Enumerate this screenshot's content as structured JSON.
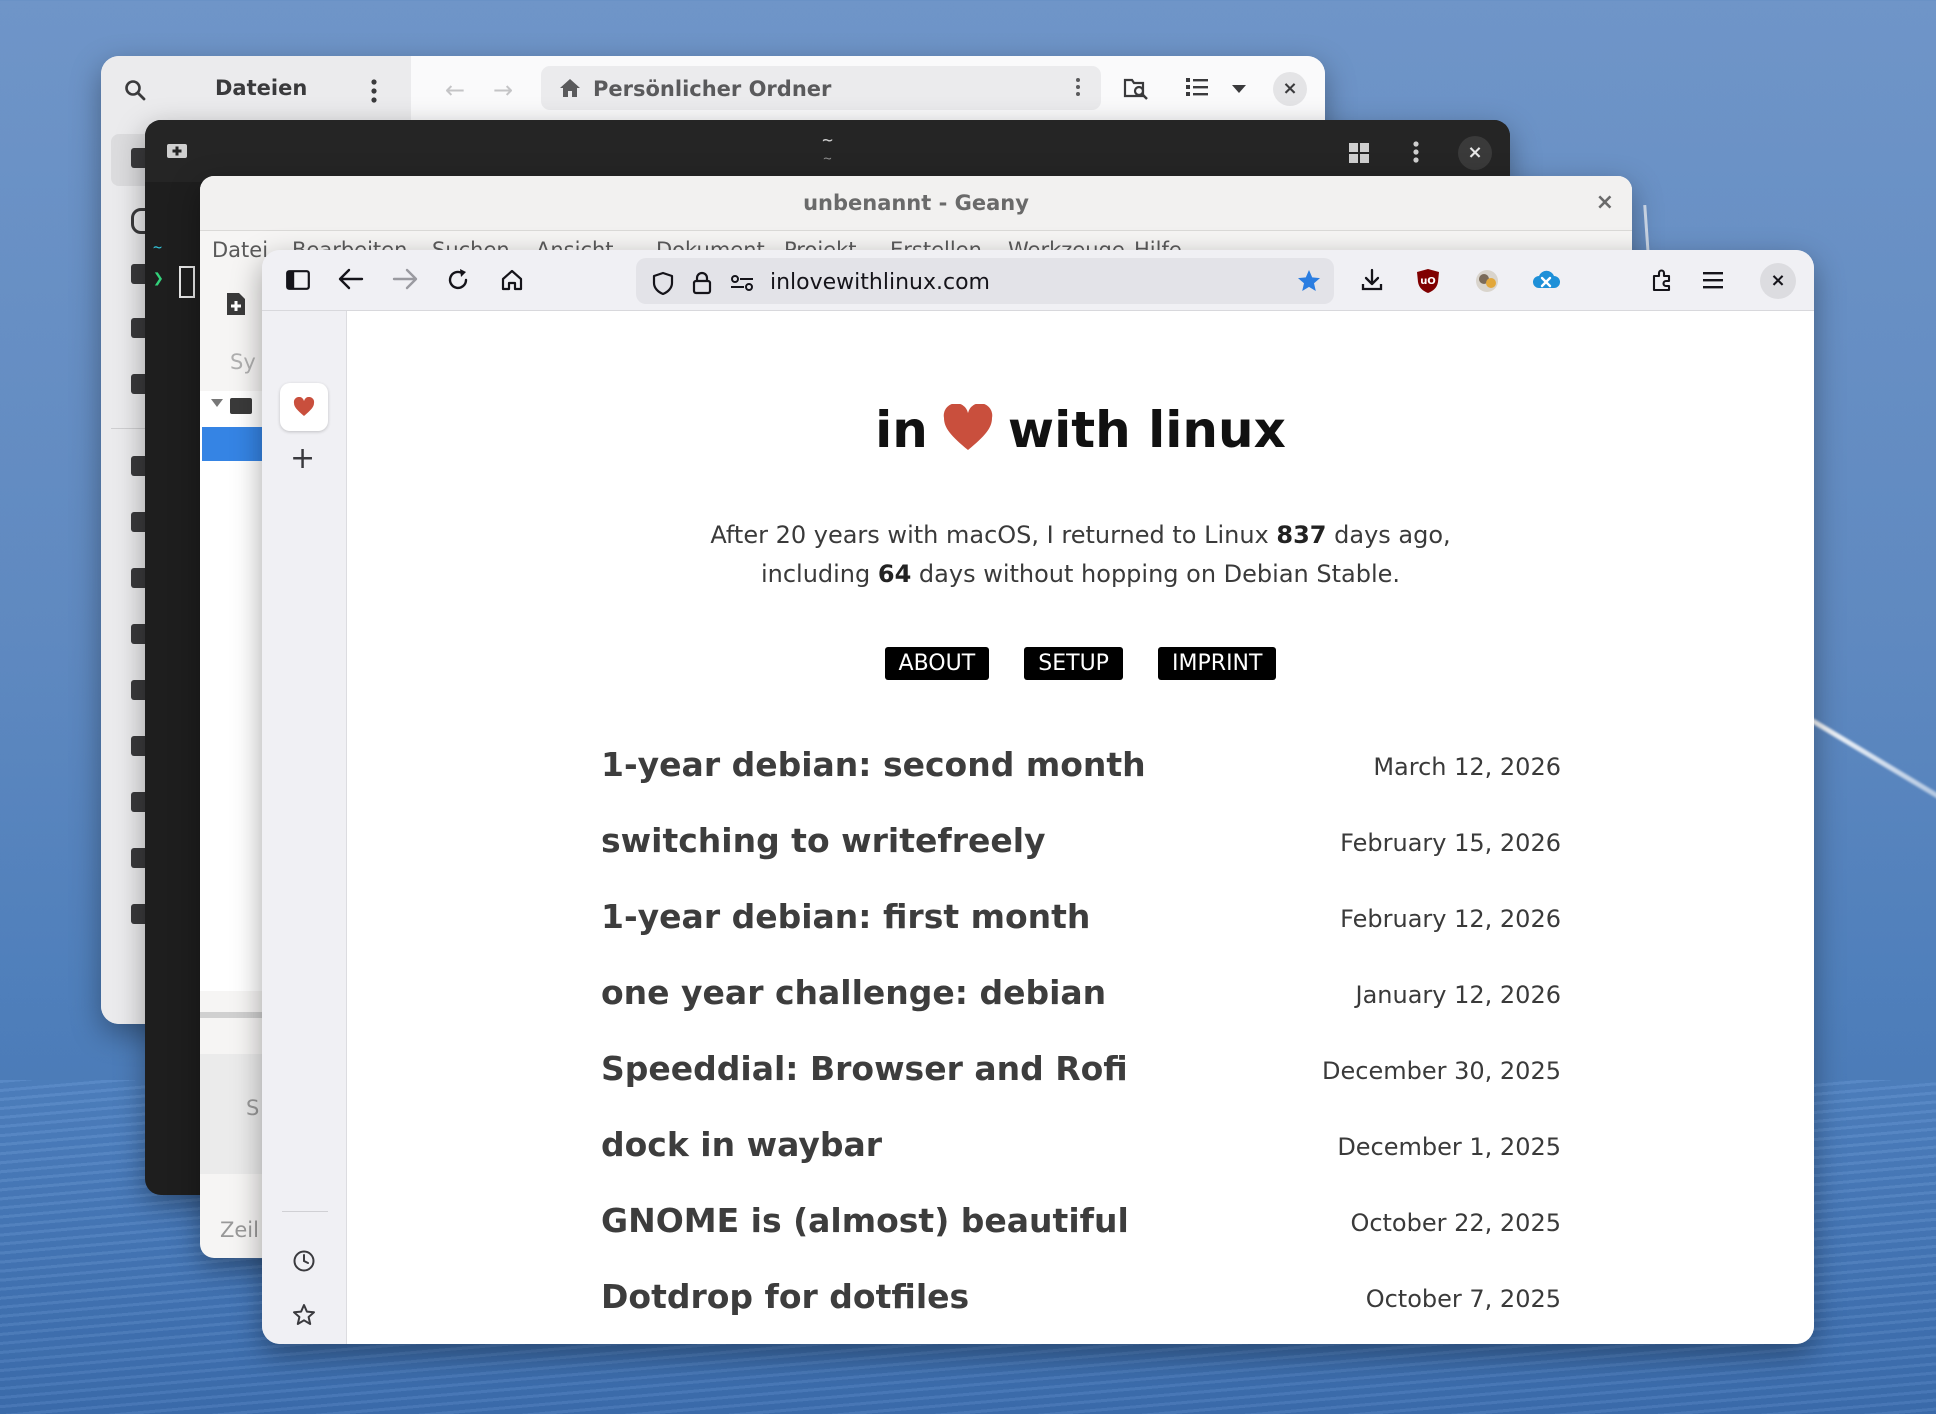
{
  "files": {
    "title": "Dateien",
    "path": "Persönlicher Ordner",
    "close": "×"
  },
  "terminal": {
    "title": "~",
    "title2": "~",
    "tilde": "~",
    "prompt": "❯",
    "close": "×"
  },
  "geany": {
    "title": "unbenannt - Geany",
    "close": "×",
    "menu": [
      "Datei",
      "Bearbeiten",
      "Suchen",
      "Ansicht",
      "Dokument",
      "Projekt",
      "Erstellen",
      "Werkzeuge",
      "Hilfe"
    ],
    "symbols_tab": "Sy",
    "status_partial": "S",
    "line_label": "Zeil"
  },
  "browser": {
    "url": "inlovewithlinux.com",
    "close": "×",
    "accent": "#2a7de1"
  },
  "site": {
    "title_before": "in",
    "title_after": "with linux",
    "heart_color": "#c94f3d",
    "intro_1a": "After 20 years with macOS, I returned to Linux ",
    "days_total": "837",
    "intro_1b": " days ago,",
    "intro_2a": "including ",
    "days_stable": "64",
    "intro_2b": " days without hopping on Debian Stable.",
    "nav": [
      "ABOUT",
      "SETUP",
      "IMPRINT"
    ],
    "posts": [
      {
        "title": "1-year debian: second month",
        "date": "March 12, 2026"
      },
      {
        "title": "switching to writefreely",
        "date": "February 15, 2026"
      },
      {
        "title": "1-year debian: first month",
        "date": "February 12, 2026"
      },
      {
        "title": "one year challenge: debian",
        "date": "January 12, 2026"
      },
      {
        "title": "Speeddial: Browser and Rofi",
        "date": "December 30, 2025"
      },
      {
        "title": "dock in waybar",
        "date": "December 1, 2025"
      },
      {
        "title": "GNOME is (almost) beautiful",
        "date": "October 22, 2025"
      },
      {
        "title": "Dotdrop for dotfiles",
        "date": "October 7, 2025"
      }
    ]
  }
}
